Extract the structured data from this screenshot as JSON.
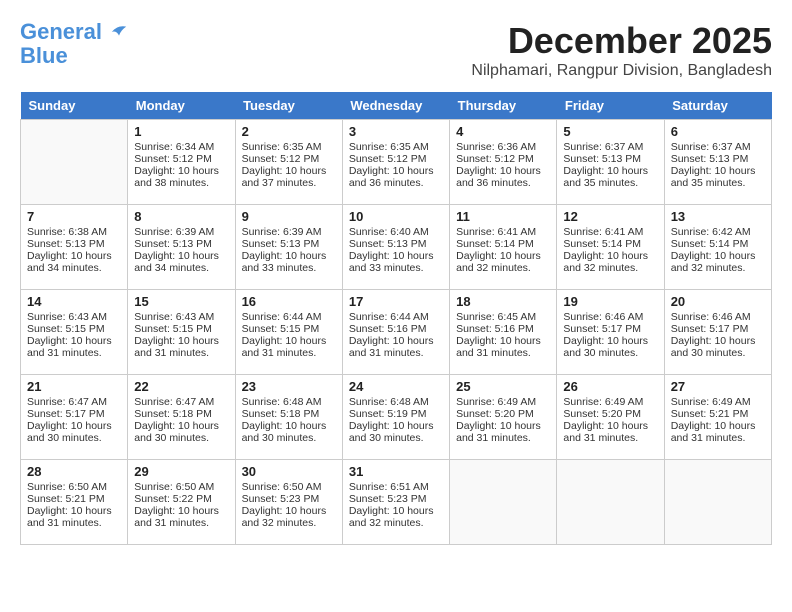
{
  "logo": {
    "line1": "General",
    "line2": "Blue"
  },
  "title": {
    "month_year": "December 2025",
    "location": "Nilphamari, Rangpur Division, Bangladesh"
  },
  "headers": [
    "Sunday",
    "Monday",
    "Tuesday",
    "Wednesday",
    "Thursday",
    "Friday",
    "Saturday"
  ],
  "weeks": [
    [
      {
        "day": "",
        "sunrise": "",
        "sunset": "",
        "daylight": ""
      },
      {
        "day": "1",
        "sunrise": "Sunrise: 6:34 AM",
        "sunset": "Sunset: 5:12 PM",
        "daylight": "Daylight: 10 hours and 38 minutes."
      },
      {
        "day": "2",
        "sunrise": "Sunrise: 6:35 AM",
        "sunset": "Sunset: 5:12 PM",
        "daylight": "Daylight: 10 hours and 37 minutes."
      },
      {
        "day": "3",
        "sunrise": "Sunrise: 6:35 AM",
        "sunset": "Sunset: 5:12 PM",
        "daylight": "Daylight: 10 hours and 36 minutes."
      },
      {
        "day": "4",
        "sunrise": "Sunrise: 6:36 AM",
        "sunset": "Sunset: 5:12 PM",
        "daylight": "Daylight: 10 hours and 36 minutes."
      },
      {
        "day": "5",
        "sunrise": "Sunrise: 6:37 AM",
        "sunset": "Sunset: 5:13 PM",
        "daylight": "Daylight: 10 hours and 35 minutes."
      },
      {
        "day": "6",
        "sunrise": "Sunrise: 6:37 AM",
        "sunset": "Sunset: 5:13 PM",
        "daylight": "Daylight: 10 hours and 35 minutes."
      }
    ],
    [
      {
        "day": "7",
        "sunrise": "Sunrise: 6:38 AM",
        "sunset": "Sunset: 5:13 PM",
        "daylight": "Daylight: 10 hours and 34 minutes."
      },
      {
        "day": "8",
        "sunrise": "Sunrise: 6:39 AM",
        "sunset": "Sunset: 5:13 PM",
        "daylight": "Daylight: 10 hours and 34 minutes."
      },
      {
        "day": "9",
        "sunrise": "Sunrise: 6:39 AM",
        "sunset": "Sunset: 5:13 PM",
        "daylight": "Daylight: 10 hours and 33 minutes."
      },
      {
        "day": "10",
        "sunrise": "Sunrise: 6:40 AM",
        "sunset": "Sunset: 5:13 PM",
        "daylight": "Daylight: 10 hours and 33 minutes."
      },
      {
        "day": "11",
        "sunrise": "Sunrise: 6:41 AM",
        "sunset": "Sunset: 5:14 PM",
        "daylight": "Daylight: 10 hours and 32 minutes."
      },
      {
        "day": "12",
        "sunrise": "Sunrise: 6:41 AM",
        "sunset": "Sunset: 5:14 PM",
        "daylight": "Daylight: 10 hours and 32 minutes."
      },
      {
        "day": "13",
        "sunrise": "Sunrise: 6:42 AM",
        "sunset": "Sunset: 5:14 PM",
        "daylight": "Daylight: 10 hours and 32 minutes."
      }
    ],
    [
      {
        "day": "14",
        "sunrise": "Sunrise: 6:43 AM",
        "sunset": "Sunset: 5:15 PM",
        "daylight": "Daylight: 10 hours and 31 minutes."
      },
      {
        "day": "15",
        "sunrise": "Sunrise: 6:43 AM",
        "sunset": "Sunset: 5:15 PM",
        "daylight": "Daylight: 10 hours and 31 minutes."
      },
      {
        "day": "16",
        "sunrise": "Sunrise: 6:44 AM",
        "sunset": "Sunset: 5:15 PM",
        "daylight": "Daylight: 10 hours and 31 minutes."
      },
      {
        "day": "17",
        "sunrise": "Sunrise: 6:44 AM",
        "sunset": "Sunset: 5:16 PM",
        "daylight": "Daylight: 10 hours and 31 minutes."
      },
      {
        "day": "18",
        "sunrise": "Sunrise: 6:45 AM",
        "sunset": "Sunset: 5:16 PM",
        "daylight": "Daylight: 10 hours and 31 minutes."
      },
      {
        "day": "19",
        "sunrise": "Sunrise: 6:46 AM",
        "sunset": "Sunset: 5:17 PM",
        "daylight": "Daylight: 10 hours and 30 minutes."
      },
      {
        "day": "20",
        "sunrise": "Sunrise: 6:46 AM",
        "sunset": "Sunset: 5:17 PM",
        "daylight": "Daylight: 10 hours and 30 minutes."
      }
    ],
    [
      {
        "day": "21",
        "sunrise": "Sunrise: 6:47 AM",
        "sunset": "Sunset: 5:17 PM",
        "daylight": "Daylight: 10 hours and 30 minutes."
      },
      {
        "day": "22",
        "sunrise": "Sunrise: 6:47 AM",
        "sunset": "Sunset: 5:18 PM",
        "daylight": "Daylight: 10 hours and 30 minutes."
      },
      {
        "day": "23",
        "sunrise": "Sunrise: 6:48 AM",
        "sunset": "Sunset: 5:18 PM",
        "daylight": "Daylight: 10 hours and 30 minutes."
      },
      {
        "day": "24",
        "sunrise": "Sunrise: 6:48 AM",
        "sunset": "Sunset: 5:19 PM",
        "daylight": "Daylight: 10 hours and 30 minutes."
      },
      {
        "day": "25",
        "sunrise": "Sunrise: 6:49 AM",
        "sunset": "Sunset: 5:20 PM",
        "daylight": "Daylight: 10 hours and 31 minutes."
      },
      {
        "day": "26",
        "sunrise": "Sunrise: 6:49 AM",
        "sunset": "Sunset: 5:20 PM",
        "daylight": "Daylight: 10 hours and 31 minutes."
      },
      {
        "day": "27",
        "sunrise": "Sunrise: 6:49 AM",
        "sunset": "Sunset: 5:21 PM",
        "daylight": "Daylight: 10 hours and 31 minutes."
      }
    ],
    [
      {
        "day": "28",
        "sunrise": "Sunrise: 6:50 AM",
        "sunset": "Sunset: 5:21 PM",
        "daylight": "Daylight: 10 hours and 31 minutes."
      },
      {
        "day": "29",
        "sunrise": "Sunrise: 6:50 AM",
        "sunset": "Sunset: 5:22 PM",
        "daylight": "Daylight: 10 hours and 31 minutes."
      },
      {
        "day": "30",
        "sunrise": "Sunrise: 6:50 AM",
        "sunset": "Sunset: 5:23 PM",
        "daylight": "Daylight: 10 hours and 32 minutes."
      },
      {
        "day": "31",
        "sunrise": "Sunrise: 6:51 AM",
        "sunset": "Sunset: 5:23 PM",
        "daylight": "Daylight: 10 hours and 32 minutes."
      },
      {
        "day": "",
        "sunrise": "",
        "sunset": "",
        "daylight": ""
      },
      {
        "day": "",
        "sunrise": "",
        "sunset": "",
        "daylight": ""
      },
      {
        "day": "",
        "sunrise": "",
        "sunset": "",
        "daylight": ""
      }
    ]
  ]
}
